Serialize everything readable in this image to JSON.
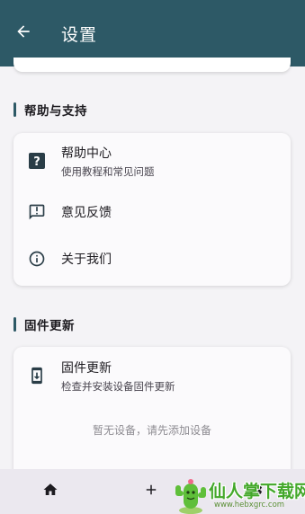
{
  "app_bar": {
    "title": "设置",
    "back_icon": "arrow-back-icon",
    "background": "#2d5966"
  },
  "sections": [
    {
      "title": "帮助与支持",
      "items": [
        {
          "title": "帮助中心",
          "subtitle": "使用教程和常见问题",
          "icon": "help-icon"
        },
        {
          "title": "意见反馈",
          "icon": "feedback-icon"
        },
        {
          "title": "关于我们",
          "icon": "info-icon"
        }
      ]
    },
    {
      "title": "固件更新",
      "items": [
        {
          "title": "固件更新",
          "subtitle": "检查并安装设备固件更新",
          "icon": "firmware-update-icon"
        }
      ],
      "empty_text": "暂无设备，请先添加设备"
    }
  ],
  "bottom_nav": {
    "items": [
      {
        "icon": "home-icon"
      },
      {
        "icon": "add-icon"
      },
      {
        "icon": "settings-icon"
      }
    ]
  },
  "watermark": {
    "text": "仙人掌下载网",
    "url": "www.hebxgrc.com"
  },
  "colors": {
    "accent": "#2d5966",
    "watermark": "#43a82a"
  }
}
